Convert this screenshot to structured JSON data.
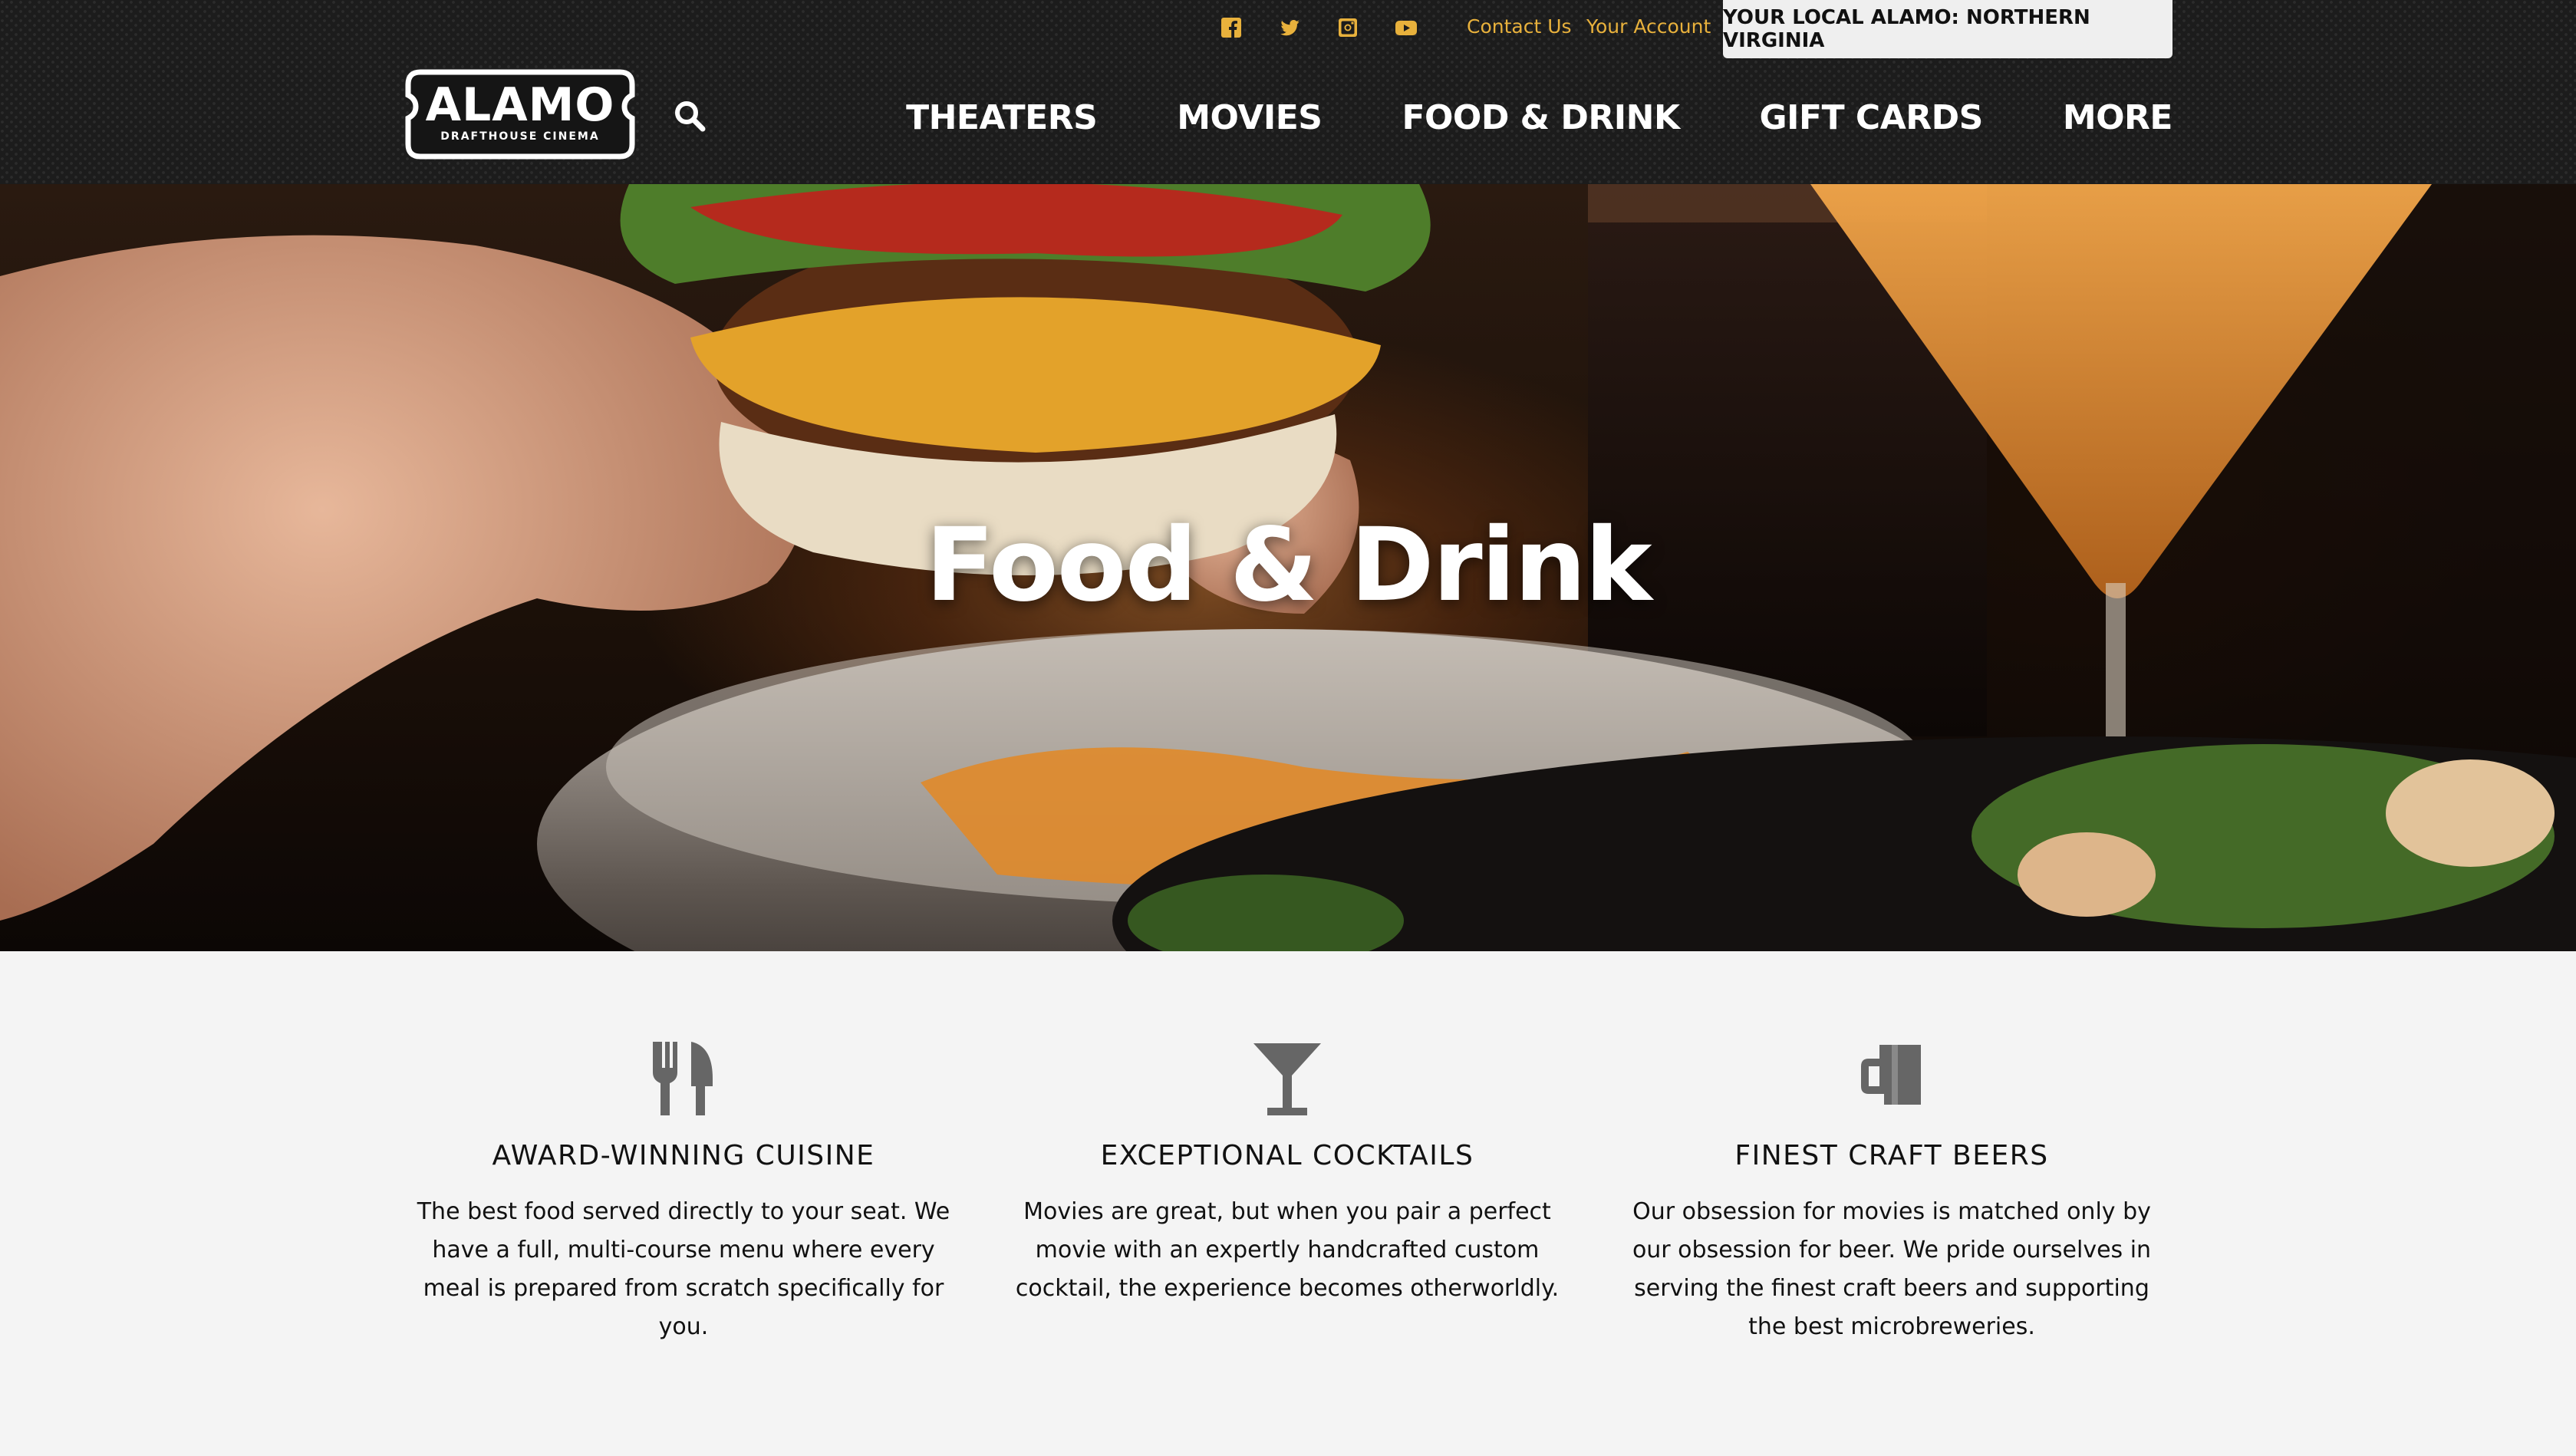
{
  "header": {
    "social": [
      {
        "name": "facebook-icon"
      },
      {
        "name": "twitter-icon"
      },
      {
        "name": "instagram-icon"
      },
      {
        "name": "youtube-icon"
      }
    ],
    "contact_label": "Contact Us",
    "account_label": "Your Account",
    "location_label": "YOUR LOCAL ALAMO: NORTHERN VIRGINIA",
    "logo": {
      "main": "ALAMO",
      "sub": "DRAFTHOUSE CINEMA"
    },
    "nav": [
      "THEATERS",
      "MOVIES",
      "FOOD & DRINK",
      "GIFT CARDS",
      "MORE"
    ],
    "accent_color": "#e8b13c"
  },
  "hero": {
    "title": "Food & Drink"
  },
  "features": [
    {
      "icon": "fork-knife-icon",
      "title": "AWARD-WINNING CUISINE",
      "text": "The best food served directly to your seat. We have a full, multi-course menu where every meal is prepared from scratch specifically for you."
    },
    {
      "icon": "cocktail-glass-icon",
      "title": "EXCEPTIONAL COCKTAILS",
      "text": "Movies are great, but when you pair a perfect movie with an expertly handcrafted custom cocktail, the experience becomes otherworldly."
    },
    {
      "icon": "beer-mug-icon",
      "title": "FINEST CRAFT BEERS",
      "text": "Our obsession for movies is matched only by our obsession for beer. We pride ourselves in serving the finest craft beers and supporting the best microbreweries."
    }
  ]
}
